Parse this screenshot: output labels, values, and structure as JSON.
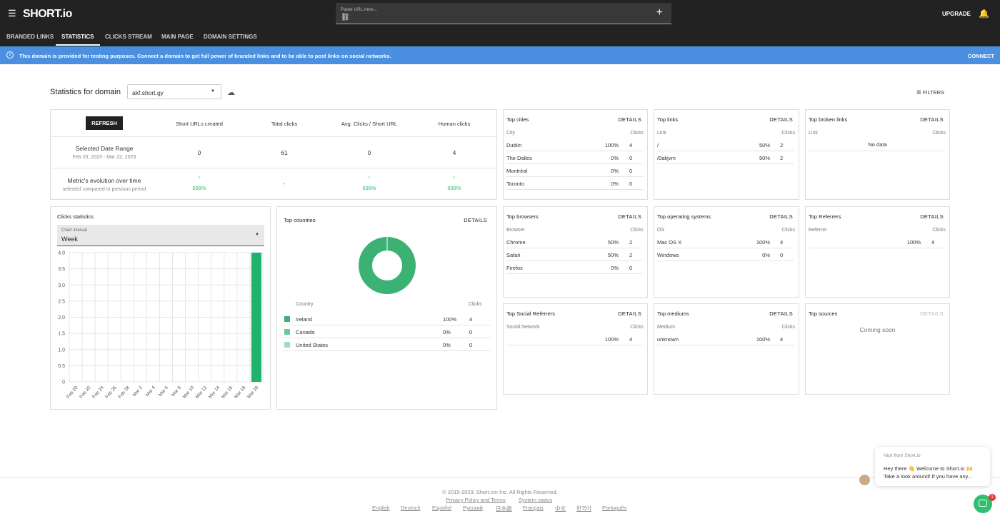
{
  "header": {
    "logo": "SHORT.io",
    "url_placeholder": "Paste URL here...",
    "upgrade": "UPGRADE",
    "tabs": [
      "BRANDED LINKS",
      "STATISTICS",
      "CLICKS STREAM",
      "MAIN PAGE",
      "DOMAIN SETTINGS"
    ],
    "active_tab": "STATISTICS"
  },
  "banner": {
    "message": "This domain is provided for testing purposes. Connect a domain to get full power of branded links and to be able to post links on social networks.",
    "action": "CONNECT",
    "color": "#4a8fe0"
  },
  "stats": {
    "title": "Statistics for domain",
    "domain": "akf.short.gy",
    "filters": "FILTERS",
    "refresh": "REFRESH",
    "headers": [
      "Short URLs created",
      "Total clicks",
      "Avg. Clicks / Short URL",
      "Human clicks"
    ],
    "date_range_label": "Selected Date Range",
    "date_range": "Feb 20, 2023 - Mar 22, 2023",
    "values": [
      "0",
      "61",
      "0",
      "4"
    ],
    "evolution_label": "Metric's evolution over time",
    "evolution_sub": "selected compared to previous period",
    "evolution": [
      "999%",
      "-",
      "999%",
      "999%"
    ]
  },
  "panels": {
    "cities": {
      "title": "Top cities",
      "details": "DETAILS",
      "col1": "City",
      "col2": "Clicks",
      "rows": [
        [
          "Dublin",
          "100%",
          "4"
        ],
        [
          "The Dalles",
          "0%",
          "0"
        ],
        [
          "Montréal",
          "0%",
          "0"
        ],
        [
          "Toronto",
          "0%",
          "0"
        ]
      ]
    },
    "links": {
      "title": "Top links",
      "details": "DETAILS",
      "col1": "Link",
      "col2": "Clicks",
      "rows": [
        [
          "/",
          "50%",
          "2"
        ],
        [
          "/0akjvm",
          "50%",
          "2"
        ]
      ]
    },
    "broken": {
      "title": "Top broken links",
      "details": "DETAILS",
      "col1": "Link",
      "col2": "Clicks",
      "empty": "No data"
    },
    "browsers": {
      "title": "Top browsers",
      "details": "DETAILS",
      "col1": "Browser",
      "col2": "Clicks",
      "rows": [
        [
          "Chrome",
          "50%",
          "2"
        ],
        [
          "Safari",
          "50%",
          "2"
        ],
        [
          "Firefox",
          "0%",
          "0"
        ]
      ]
    },
    "os": {
      "title": "Top operating systems",
      "details": "DETAILS",
      "col1": "OS",
      "col2": "Clicks",
      "rows": [
        [
          "Mac OS X",
          "100%",
          "4"
        ],
        [
          "Windows",
          "0%",
          "0"
        ]
      ]
    },
    "referrers": {
      "title": "Top Referrers",
      "details": "DETAILS",
      "col1": "Referrer",
      "col2": "Clicks",
      "rows": [
        [
          "",
          "100%",
          "4"
        ]
      ]
    },
    "social": {
      "title": "Top Social Referrers",
      "details": "DETAILS",
      "col1": "Social Network",
      "col2": "Clicks",
      "rows": [
        [
          "",
          "100%",
          "4"
        ]
      ]
    },
    "mediums": {
      "title": "Top mediums",
      "details": "DETAILS",
      "col1": "Medium",
      "col2": "Clicks",
      "rows": [
        [
          "unknown",
          "100%",
          "4"
        ]
      ]
    },
    "sources": {
      "title": "Top sources",
      "details": "DETAILS",
      "coming": "Coming soon"
    }
  },
  "clicks_chart": {
    "title": "Clicks statistics",
    "interval_label": "Chart interval",
    "interval": "Week"
  },
  "chart_data": {
    "type": "bar",
    "categories": [
      "Feb 20",
      "Feb 22",
      "Feb 24",
      "Feb 26",
      "Feb 28",
      "Mar 2",
      "Mar 4",
      "Mar 6",
      "Mar 8",
      "Mar 10",
      "Mar 12",
      "Mar 14",
      "Mar 16",
      "Mar 18",
      "Mar 20"
    ],
    "values": [
      0,
      0,
      0,
      0,
      0,
      0,
      0,
      0,
      0,
      0,
      0,
      0,
      0,
      0,
      4
    ],
    "yticks": [
      "0",
      "0.5",
      "1.0",
      "1.5",
      "2.0",
      "2.5",
      "3.0",
      "3.5",
      "4.0"
    ],
    "ylim": [
      0,
      4
    ],
    "grid": true,
    "color": "#1fb36b"
  },
  "countries": {
    "title": "Top countries",
    "details": "DETAILS",
    "col1": "Country",
    "col2": "Clicks",
    "rows": [
      {
        "name": "Ireland",
        "pct": "100%",
        "clicks": "4",
        "color": "#3bb273"
      },
      {
        "name": "Canada",
        "pct": "0%",
        "clicks": "0",
        "color": "#6cc79a"
      },
      {
        "name": "United States",
        "pct": "0%",
        "clicks": "0",
        "color": "#9ddcbc"
      }
    ]
  },
  "footer": {
    "copyright": "© 2015-2023. Short.cm Inc. All Rights Reserved.",
    "privacy": "Privacy Policy and Terms",
    "status": "System status",
    "languages": [
      "English",
      "Deutsch",
      "Español",
      "Русский",
      "日本語",
      "Français",
      "中文",
      "한국어",
      "Português"
    ]
  },
  "chat": {
    "from": "Nick from Short.io",
    "message": "Hey there 👋 Welcome to Short.io 🙌 Take a look around! If you have any...",
    "badge": "1"
  }
}
